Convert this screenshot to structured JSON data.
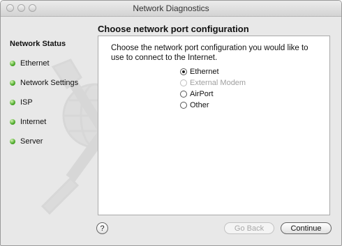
{
  "window": {
    "title": "Network Diagnostics"
  },
  "sidebar": {
    "heading": "Network Status",
    "steps": [
      {
        "label": "Ethernet",
        "status_color": "#4caa2a"
      },
      {
        "label": "Network Settings",
        "status_color": "#4caa2a"
      },
      {
        "label": "ISP",
        "status_color": "#4caa2a"
      },
      {
        "label": "Internet",
        "status_color": "#4caa2a"
      },
      {
        "label": "Server",
        "status_color": "#4caa2a"
      }
    ]
  },
  "main": {
    "title": "Choose network port configuration",
    "prompt": "Choose the network port configuration you would like to use to connect to the Internet.",
    "options": [
      {
        "label": "Ethernet",
        "selected": true,
        "enabled": true
      },
      {
        "label": "External Modem",
        "selected": false,
        "enabled": false
      },
      {
        "label": "AirPort",
        "selected": false,
        "enabled": true
      },
      {
        "label": "Other",
        "selected": false,
        "enabled": true
      }
    ]
  },
  "footer": {
    "help_label": "?",
    "back_label": "Go Back",
    "continue_label": "Continue"
  }
}
